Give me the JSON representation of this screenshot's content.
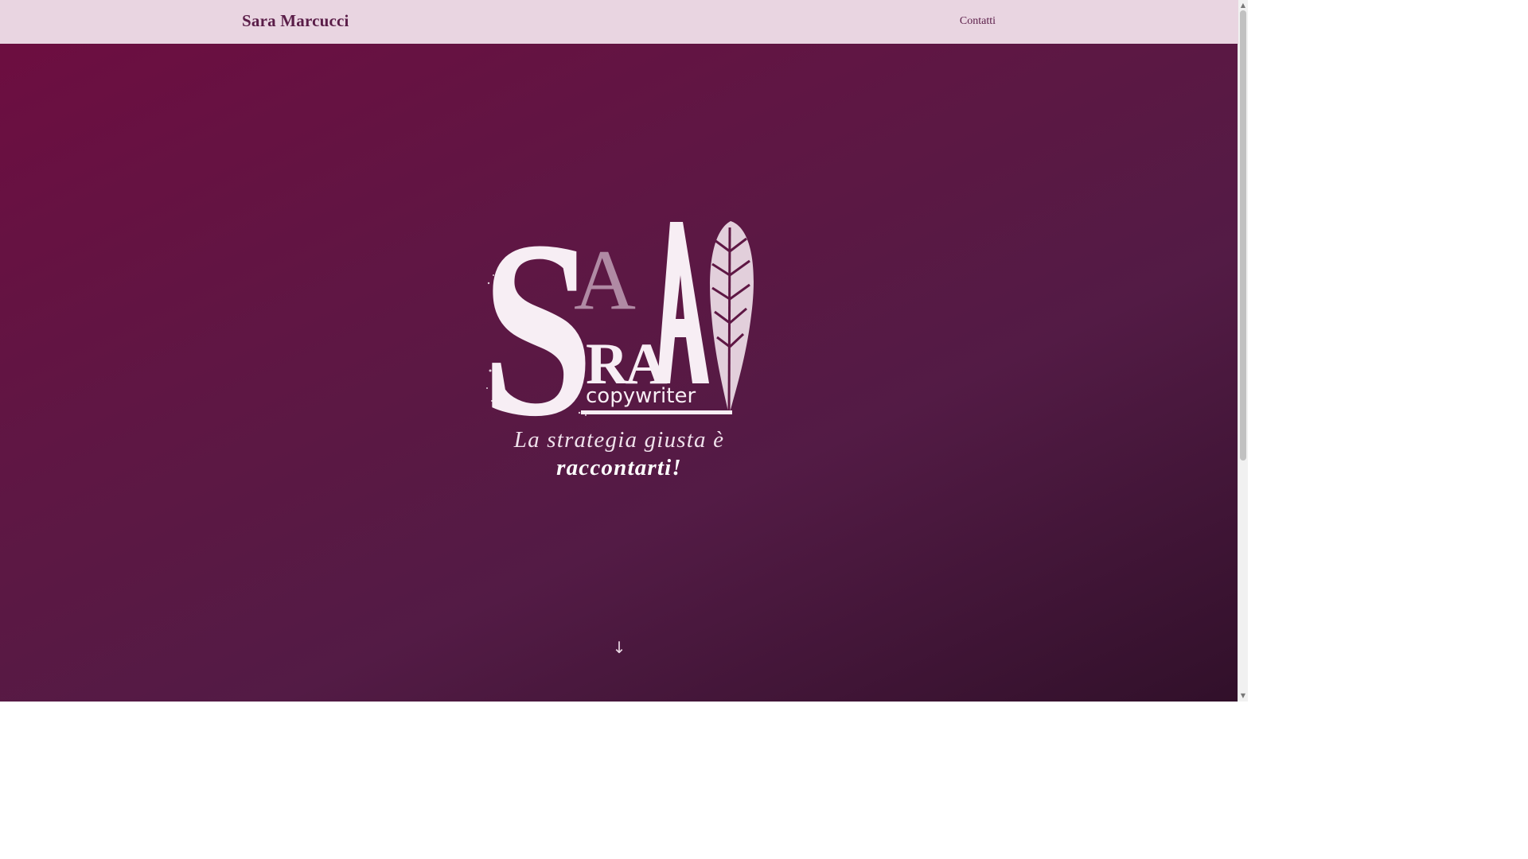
{
  "header": {
    "brand": "Sara Marcucci",
    "nav_contact": "Contatti"
  },
  "hero": {
    "logo_text": {
      "s": "S",
      "a_small": "A",
      "ra": "RA",
      "tagline": "copywriter"
    },
    "tagline_line1": "La strategia giusta è",
    "tagline_line2": "raccontarti!",
    "scroll_glyph": "↓"
  },
  "colors": {
    "navbar_bg": "#e9d5e1",
    "brand_text": "#5a1d48",
    "hero_gradient_start": "#6e0d40",
    "hero_gradient_end": "#31102a",
    "logo_white": "#f7eef4",
    "logo_muted": "#b08aa4"
  },
  "scrollbar": {
    "up_glyph": "▲",
    "down_glyph": "▼"
  }
}
